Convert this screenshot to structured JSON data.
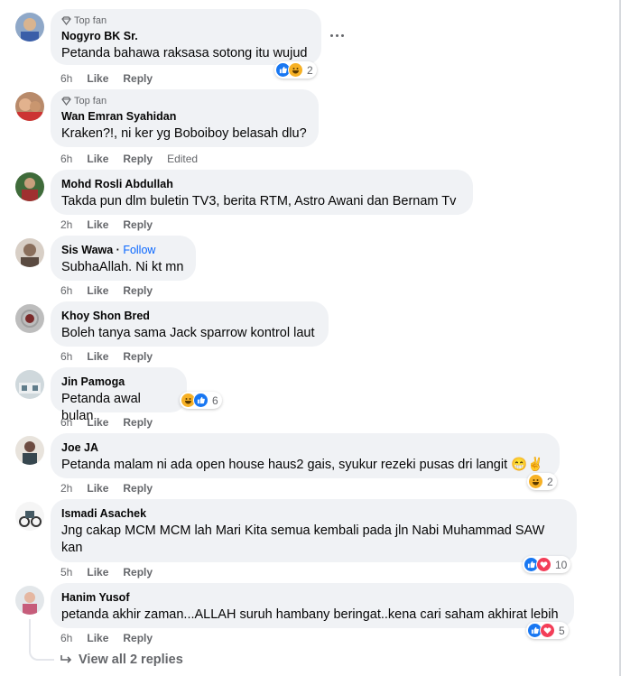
{
  "comments": [
    {
      "name": "Nogyro BK Sr.",
      "badge": "Top fan",
      "text": "Petanda bahawa raksasa sotong itu wujud",
      "time": "6h",
      "like": "Like",
      "reply": "Reply",
      "reaction_count": "2"
    },
    {
      "name": "Wan Emran Syahidan",
      "badge": "Top fan",
      "text": "Kraken?!, ni ker yg Boboiboy belasah dlu?",
      "time": "6h",
      "like": "Like",
      "reply": "Reply",
      "edited": "Edited"
    },
    {
      "name": "Mohd Rosli Abdullah",
      "text": "Takda pun dlm buletin TV3, berita RTM, Astro Awani dan Bernam Tv",
      "time": "2h",
      "like": "Like",
      "reply": "Reply"
    },
    {
      "name": "Sis Wawa",
      "follow": "Follow",
      "text": "SubhaAllah. Ni kt mn",
      "time": "6h",
      "like": "Like",
      "reply": "Reply"
    },
    {
      "name": "Khoy Shon Bred",
      "text": "Boleh tanya sama Jack sparrow kontrol laut",
      "time": "6h",
      "like": "Like",
      "reply": "Reply"
    },
    {
      "name": "Jin Pamoga",
      "text": "Petanda awal bulan",
      "time": "6h",
      "like": "Like",
      "reply": "Reply",
      "reaction_count": "6"
    },
    {
      "name": "Joe JA",
      "text": "Petanda malam ni ada open house haus2 gais, syukur rezeki pusas dri langit 😁✌️",
      "time": "2h",
      "like": "Like",
      "reply": "Reply",
      "reaction_count": "2"
    },
    {
      "name": "Ismadi Asachek",
      "text": "Jng cakap MCM MCM lah Mari Kita semua kembali pada jln Nabi Muhammad SAW kan",
      "time": "5h",
      "like": "Like",
      "reply": "Reply",
      "reaction_count": "10"
    },
    {
      "name": "Hanim Yusof",
      "text": "petanda akhir zaman...ALLAH suruh hambany beringat..kena cari saham akhirat lebih",
      "time": "6h",
      "like": "Like",
      "reply": "Reply",
      "reaction_count": "5"
    }
  ],
  "view_replies": "View all 2 replies",
  "icons": {
    "badge": "diamond-icon",
    "more": "more-options-icon",
    "reply_arrow": "reply-arrow-icon"
  },
  "colors": {
    "bubble": "#f0f2f5",
    "meta": "#65676b",
    "link": "#0866ff",
    "like": "#1877f2",
    "love": "#f33e58",
    "haha": "#f7b125"
  }
}
